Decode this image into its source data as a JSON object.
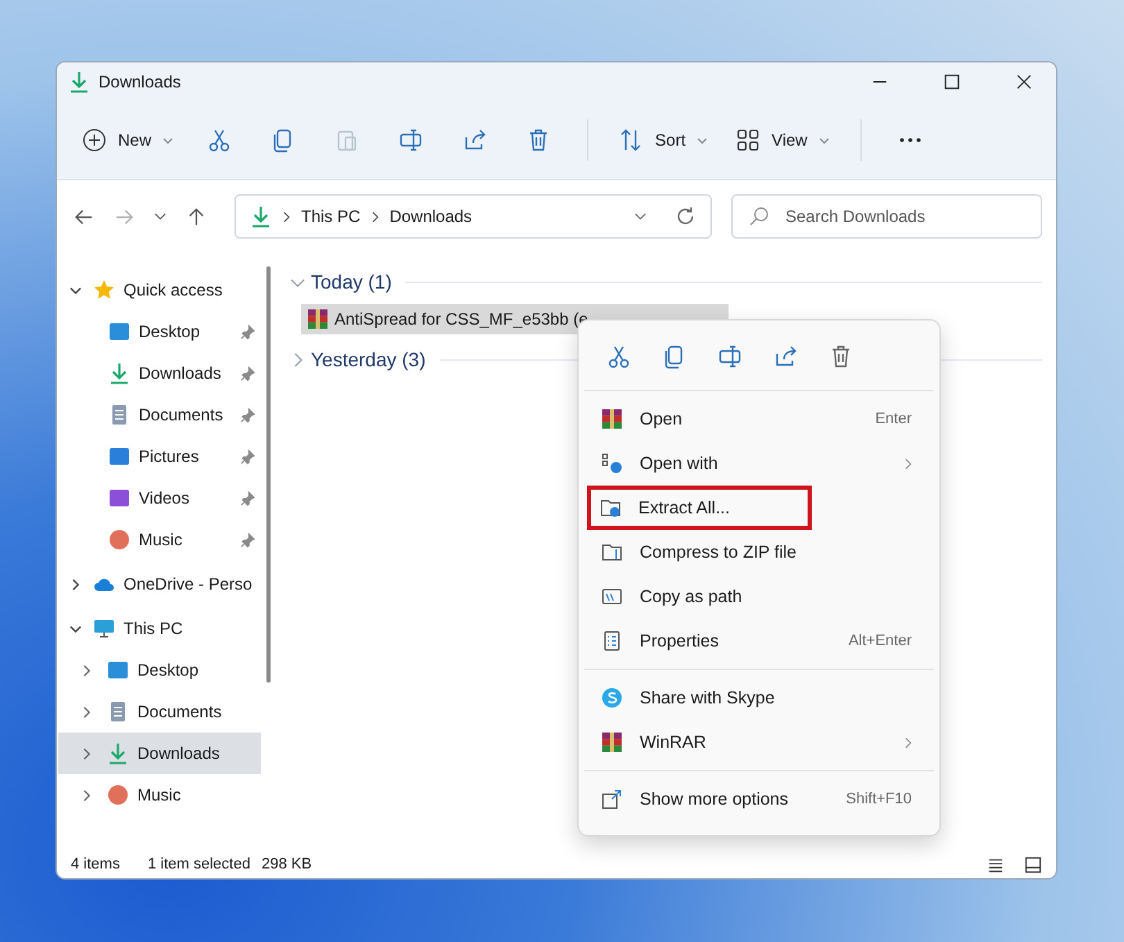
{
  "window": {
    "title": "Downloads"
  },
  "toolbar": {
    "new": "New",
    "sort": "Sort",
    "view": "View",
    "actions": [
      {
        "kind": "cut",
        "disabled": false
      },
      {
        "kind": "copy",
        "disabled": false
      },
      {
        "kind": "paste",
        "disabled": true
      },
      {
        "kind": "rename",
        "disabled": false
      },
      {
        "kind": "share",
        "disabled": false
      },
      {
        "kind": "delete",
        "disabled": false
      }
    ]
  },
  "address": {
    "forward_disabled": true,
    "crumbs": [
      "This PC",
      "Downloads"
    ],
    "search_placeholder": "Search Downloads"
  },
  "sidebar": {
    "items": [
      {
        "label": "Quick access",
        "expanded": true,
        "selected": false,
        "children": [
          {
            "label": "Desktop",
            "pinned": true,
            "selected": false
          },
          {
            "label": "Downloads",
            "pinned": true,
            "selected": false
          },
          {
            "label": "Documents",
            "pinned": true,
            "selected": false
          },
          {
            "label": "Pictures",
            "pinned": true,
            "selected": false
          },
          {
            "label": "Videos",
            "pinned": true,
            "selected": false
          },
          {
            "label": "Music",
            "pinned": true,
            "selected": false
          }
        ]
      },
      {
        "label": "OneDrive - Perso",
        "expanded": false,
        "selected": false
      },
      {
        "label": "This PC",
        "expanded": true,
        "selected": false,
        "children": [
          {
            "label": "Desktop",
            "pinned": false,
            "selected": false
          },
          {
            "label": "Documents",
            "pinned": false,
            "selected": false
          },
          {
            "label": "Downloads",
            "pinned": false,
            "selected": true
          },
          {
            "label": "Music",
            "pinned": false,
            "selected": false
          }
        ]
      }
    ]
  },
  "groups": [
    {
      "label": "Today (1)",
      "expanded": true,
      "files": [
        {
          "name": "AntiSpread for CSS_MF_e53bb (e",
          "selected": true
        }
      ]
    },
    {
      "label": "Yesterday (3)",
      "expanded": false
    }
  ],
  "context_menu": {
    "sections": [
      [
        {
          "label": "Open",
          "shortcut": "Enter",
          "submenu": false,
          "highlighted": false
        },
        {
          "label": "Open with",
          "submenu": true,
          "highlighted": false
        },
        {
          "label": "Extract All...",
          "submenu": false,
          "highlighted": true
        },
        {
          "label": "Compress to ZIP file",
          "submenu": false,
          "highlighted": false
        },
        {
          "label": "Copy as path",
          "submenu": false,
          "highlighted": false
        },
        {
          "label": "Properties",
          "shortcut": "Alt+Enter",
          "submenu": false,
          "highlighted": false
        }
      ],
      [
        {
          "label": "Share with Skype",
          "submenu": false,
          "highlighted": false
        },
        {
          "label": "WinRAR",
          "submenu": true,
          "highlighted": false
        }
      ],
      [
        {
          "label": "Show more options",
          "shortcut": "Shift+F10",
          "submenu": false,
          "highlighted": false
        }
      ]
    ]
  },
  "status_bar": {
    "items": "4 items",
    "selection": "1 item selected",
    "size": "298 KB"
  }
}
